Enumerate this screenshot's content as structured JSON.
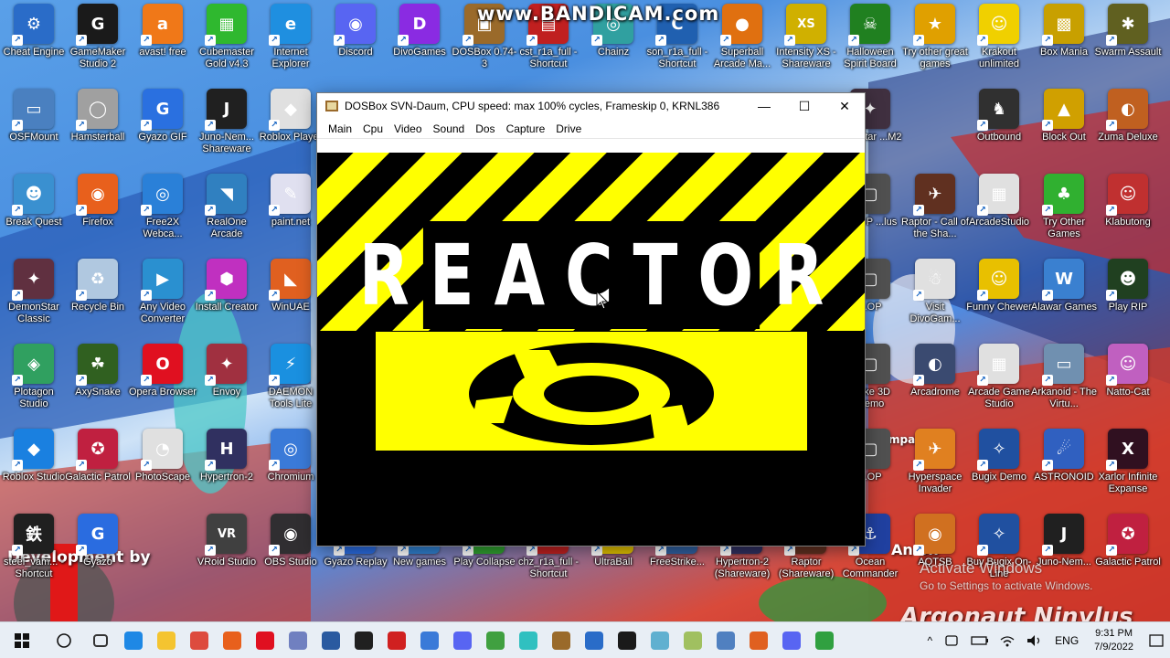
{
  "watermark": "www.BANDICAM.com",
  "wallpaper_texts": {
    "development": "Development by",
    "argonaut": "Argonaut Ninylus",
    "andon": "An on",
    "company": "Company"
  },
  "desktop_icons": [
    {
      "label": "Cheat Engine",
      "color": "#2a6cc8",
      "glyph": "⚙"
    },
    {
      "label": "GameMaker Studio 2",
      "color": "#1a1a1a",
      "glyph": "G"
    },
    {
      "label": "avast! free",
      "color": "#f07818",
      "glyph": "a"
    },
    {
      "label": "Cubemaster Gold v4.3",
      "color": "#2fb82f",
      "glyph": "▦"
    },
    {
      "label": "Internet Explorer",
      "color": "#1f8fe0",
      "glyph": "e"
    },
    {
      "label": "Discord",
      "color": "#5865f2",
      "glyph": "◉"
    },
    {
      "label": "DivoGames",
      "color": "#8a2be2",
      "glyph": "D"
    },
    {
      "label": "DOSBox 0.74-3",
      "color": "#9a6a2a",
      "glyph": "▣"
    },
    {
      "label": "cst_r1a_full - Shortcut",
      "color": "#c02020",
      "glyph": "▤"
    },
    {
      "label": "Chainz",
      "color": "#30a0a0",
      "glyph": "◎"
    },
    {
      "label": "son_r1a_full - Shortcut",
      "color": "#2060b0",
      "glyph": "C"
    },
    {
      "label": "Superball Arcade Ma...",
      "color": "#e07010",
      "glyph": "●"
    },
    {
      "label": "Intensity XS - Shareware",
      "color": "#d0b000",
      "glyph": "XS"
    },
    {
      "label": "Halloween Spirit Board",
      "color": "#208020",
      "glyph": "☠"
    },
    {
      "label": "Try other great games",
      "color": "#e0a000",
      "glyph": "★"
    },
    {
      "label": "Krakout unlimited",
      "color": "#f0d000",
      "glyph": "☺"
    },
    {
      "label": "Box Mania",
      "color": "#c8a000",
      "glyph": "▩"
    },
    {
      "label": "Swarm Assault",
      "color": "#606020",
      "glyph": "✱"
    },
    {
      "label": "OSFMount",
      "color": "#4a80c0",
      "glyph": "▭"
    },
    {
      "label": "Hamsterball",
      "color": "#a0a0a0",
      "glyph": "◯"
    },
    {
      "label": "Gyazo GIF",
      "color": "#2a70e0",
      "glyph": "G"
    },
    {
      "label": "Juno-Nem... Shareware",
      "color": "#202020",
      "glyph": "J"
    },
    {
      "label": "Roblox Player",
      "color": "#e0e0e0",
      "glyph": "◆"
    },
    {
      "label": "Outbound",
      "color": "#303030",
      "glyph": "♞"
    },
    {
      "label": "Block Out",
      "color": "#d0a000",
      "glyph": "▲"
    },
    {
      "label": "Zuma Deluxe",
      "color": "#c06020",
      "glyph": "◐"
    },
    {
      "label": "Break Quest",
      "color": "#3a90d0",
      "glyph": "☻"
    },
    {
      "label": "Firefox",
      "color": "#e8601c",
      "glyph": "◉"
    },
    {
      "label": "Free2X Webca...",
      "color": "#2a80d8",
      "glyph": "◎"
    },
    {
      "label": "RealOne Arcade",
      "color": "#3080c0",
      "glyph": "◥"
    },
    {
      "label": "paint.net",
      "color": "#e0e0f0",
      "glyph": "✎"
    },
    {
      "label": "Raptor - Call of the Sha...",
      "color": "#603020",
      "glyph": "✈"
    },
    {
      "label": "ArcadeStudio",
      "color": "#e0e0e0",
      "glyph": "▦"
    },
    {
      "label": "Try Other Games",
      "color": "#30b030",
      "glyph": "♣"
    },
    {
      "label": "Klabutong",
      "color": "#c03030",
      "glyph": "☺"
    },
    {
      "label": "DemonStar Classic",
      "color": "#603040",
      "glyph": "✦"
    },
    {
      "label": "Recycle Bin",
      "color": "#b0c8e0",
      "glyph": "♻"
    },
    {
      "label": "Any Video Converter",
      "color": "#2a90d0",
      "glyph": "▶"
    },
    {
      "label": "Install Creator",
      "color": "#c030c0",
      "glyph": "⬢"
    },
    {
      "label": "WinUAE",
      "color": "#e06020",
      "glyph": "◣"
    },
    {
      "label": "Visit DivoGam...",
      "color": "#e0e0e0",
      "glyph": "☃"
    },
    {
      "label": "Funny Chewer",
      "color": "#e8c000",
      "glyph": "☺"
    },
    {
      "label": "Alawar Games",
      "color": "#3a80d0",
      "glyph": "W"
    },
    {
      "label": "Play RIP",
      "color": "#204020",
      "glyph": "☻"
    },
    {
      "label": "Plotagon Studio",
      "color": "#30a060",
      "glyph": "◈"
    },
    {
      "label": "AxySnake",
      "color": "#306020",
      "glyph": "☘"
    },
    {
      "label": "Opera Browser",
      "color": "#e01020",
      "glyph": "O"
    },
    {
      "label": "Envoy",
      "color": "#a03040",
      "glyph": "✦"
    },
    {
      "label": "DAEMON Tools Lite",
      "color": "#1a90e0",
      "glyph": "⚡"
    },
    {
      "label": "Arcadrome",
      "color": "#3a4a70",
      "glyph": "◐"
    },
    {
      "label": "Arcade Game Studio",
      "color": "#e0e0e0",
      "glyph": "▦"
    },
    {
      "label": "Arkanoid - The Virtu...",
      "color": "#7090b0",
      "glyph": "▭"
    },
    {
      "label": "Natto-Cat",
      "color": "#c060c0",
      "glyph": "☺"
    },
    {
      "label": "Roblox Studio",
      "color": "#1a80e0",
      "glyph": "◆"
    },
    {
      "label": "Galactic Patrol",
      "color": "#c02040",
      "glyph": "✪"
    },
    {
      "label": "PhotoScape",
      "color": "#e0e0e0",
      "glyph": "◔"
    },
    {
      "label": "Hypertron-2",
      "color": "#303060",
      "glyph": "H"
    },
    {
      "label": "Chromium",
      "color": "#3a7ad8",
      "glyph": "◎"
    },
    {
      "label": "Hyperspace Invader",
      "color": "#e08020",
      "glyph": "✈"
    },
    {
      "label": "Bugix Demo",
      "color": "#2050a0",
      "glyph": "✧"
    },
    {
      "label": "ASTRONOID",
      "color": "#3060c0",
      "glyph": "☄"
    },
    {
      "label": "Xarlor Infinite Expanse",
      "color": "#301020",
      "glyph": "X"
    },
    {
      "label": "steel_vam... - Shortcut",
      "color": "#202020",
      "glyph": "鉄"
    },
    {
      "label": "Gyazo",
      "color": "#2a6ce0",
      "glyph": "G"
    },
    {
      "label": "VRoid Studio",
      "color": "#404040",
      "glyph": "VR"
    },
    {
      "label": "OBS Studio",
      "color": "#302e31",
      "glyph": "◉"
    },
    {
      "label": "Gyazo Replay",
      "color": "#2a6ce0",
      "glyph": "↻"
    },
    {
      "label": "New games",
      "color": "#3080d0",
      "glyph": "★"
    },
    {
      "label": "Play Collapse",
      "color": "#30a030",
      "glyph": "▦"
    },
    {
      "label": "chz_r1a_full - Shortcut",
      "color": "#c02020",
      "glyph": "▤"
    },
    {
      "label": "UltraBall",
      "color": "#e0c000",
      "glyph": "●"
    },
    {
      "label": "FreeStrike...",
      "color": "#3060a0",
      "glyph": "✈"
    },
    {
      "label": "Hypertron-2 (Shareware)",
      "color": "#303060",
      "glyph": "H"
    },
    {
      "label": "Raptor (Shareware)",
      "color": "#603020",
      "glyph": "✈"
    },
    {
      "label": "Ocean Commander",
      "color": "#2040a0",
      "glyph": "⚓"
    },
    {
      "label": "AQTSB",
      "color": "#d07020",
      "glyph": "◉"
    },
    {
      "label": "Buy Bugix On-Line",
      "color": "#2050a0",
      "glyph": "✧"
    },
    {
      "label": "Juno-Nem...",
      "color": "#202020",
      "glyph": "J"
    },
    {
      "label": "Galactic Patrol",
      "color": "#c02040",
      "glyph": "✪"
    },
    {
      "label": "...onStar ...M2",
      "color": "#403040",
      "glyph": "✦"
    },
    {
      "label": "...XOP ...lus",
      "color": "#505050",
      "glyph": "▢"
    },
    {
      "label": "...OP",
      "color": "#505050",
      "glyph": "▢"
    },
    {
      "label": "...ake 3D ...emo",
      "color": "#505050",
      "glyph": "▢"
    },
    {
      "label": "...OP",
      "color": "#505050",
      "glyph": "▢"
    }
  ],
  "dosbox": {
    "title": "DOSBox SVN-Daum, CPU speed: max 100% cycles, Frameskip  0,  KRNL386",
    "minimize": "—",
    "maximize": "☐",
    "close": "✕",
    "menu": [
      "Main",
      "Cpu",
      "Video",
      "Sound",
      "Dos",
      "Capture",
      "Drive"
    ],
    "game_title": "REACTOR",
    "colors": {
      "yellow": "#ffff00",
      "black": "#000000"
    }
  },
  "activate_windows": {
    "line1": "Activate Windows",
    "line2": "Go to Settings to activate Windows."
  },
  "taskbar": {
    "start_icon": "windows-logo",
    "search_icon": "circle",
    "pinned": [
      {
        "name": "task-view",
        "color": "#333333"
      },
      {
        "name": "edge",
        "color": "#1e88e5"
      },
      {
        "name": "file-explorer",
        "color": "#f4c430"
      },
      {
        "name": "chrome",
        "color": "#dd4b3e"
      },
      {
        "name": "firefox",
        "color": "#e8601c"
      },
      {
        "name": "opera",
        "color": "#e01020"
      },
      {
        "name": "paint-net",
        "color": "#7080c0"
      },
      {
        "name": "app-blue",
        "color": "#2a5aa0"
      },
      {
        "name": "bandicam",
        "color": "#202020"
      },
      {
        "name": "record",
        "color": "#d02020"
      },
      {
        "name": "chromium",
        "color": "#3a7ad8"
      },
      {
        "name": "discord-2",
        "color": "#5865f2"
      },
      {
        "name": "app-green",
        "color": "#40a040"
      },
      {
        "name": "miku",
        "color": "#30c0c0"
      },
      {
        "name": "dosbox",
        "color": "#9a6a2a"
      },
      {
        "name": "cheat-engine",
        "color": "#2a6cc8"
      },
      {
        "name": "gamemaker",
        "color": "#1a1a1a"
      },
      {
        "name": "app-cyan",
        "color": "#60b0d0"
      },
      {
        "name": "app-notepad",
        "color": "#a0c060"
      },
      {
        "name": "app-paint",
        "color": "#5080c0"
      },
      {
        "name": "photoscape",
        "color": "#e06020"
      },
      {
        "name": "discord",
        "color": "#5865f2"
      },
      {
        "name": "app-misc",
        "color": "#30a040"
      }
    ],
    "tray": {
      "chevron": "^",
      "language": "ENG",
      "time": "9:31 PM",
      "date": "7/9/2022"
    }
  }
}
